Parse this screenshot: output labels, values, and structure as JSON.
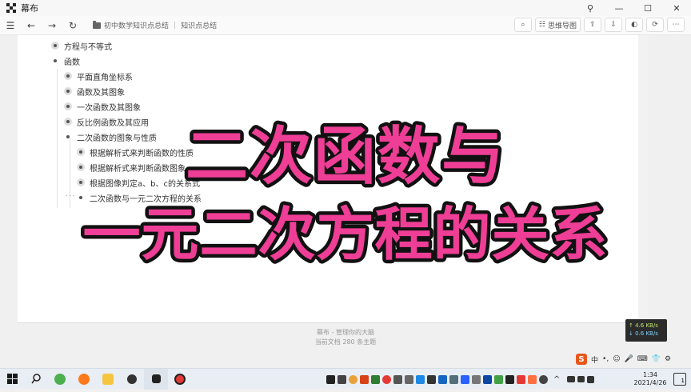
{
  "window": {
    "title": "幕布",
    "controls": {
      "pin": "⚲",
      "minimize": "—",
      "maximize": "☐",
      "close": "✕"
    }
  },
  "toolbar": {
    "menu_icon": "hamburger-icon",
    "back_icon": "arrow-left-icon",
    "forward_icon": "arrow-right-icon",
    "refresh_icon": "refresh-icon",
    "breadcrumb": [
      "初中数学知识点总结",
      "知识点总结"
    ],
    "breadcrumb_sep": "|",
    "mindmap_label": "思维导图",
    "right_icons": [
      "search-doc-icon",
      "mindmap-icon",
      "share-icon",
      "export-icon",
      "theme-icon",
      "history-icon",
      "more-icon"
    ]
  },
  "outline": {
    "items": [
      {
        "text": "方程与不等式",
        "level": 0,
        "collapsed": true
      },
      {
        "text": "函数",
        "level": 0,
        "collapsed": false
      },
      {
        "text": "平面直角坐标系",
        "level": 1,
        "collapsed": true
      },
      {
        "text": "函数及其图象",
        "level": 1,
        "collapsed": true
      },
      {
        "text": "一次函数及其图象",
        "level": 1,
        "collapsed": true
      },
      {
        "text": "反比例函数及其应用",
        "level": 1,
        "collapsed": true
      },
      {
        "text": "二次函数的图象与性质",
        "level": 1,
        "collapsed": false
      },
      {
        "text": "根据解析式来判断函数的性质",
        "level": 2,
        "collapsed": true
      },
      {
        "text": "根据解析式来判断函数图象",
        "level": 2,
        "collapsed": true
      },
      {
        "text": "根据图像判定a、b、c的关系式",
        "level": 2,
        "collapsed": true
      },
      {
        "text": "二次函数与一元二次方程的关系",
        "level": 2,
        "collapsed": false
      }
    ],
    "more_dots": "···"
  },
  "overlay": {
    "line1": "二次函数与",
    "line2": "一元二次方程的关系",
    "fill_color": "#ee3e96",
    "stroke_color": "#111111"
  },
  "footer": {
    "line1": "幕布 - 管理你的大脑",
    "line2": "当前文档 280 条主题"
  },
  "netspeed": {
    "up": "↑ 4.6 KB/s",
    "down": "↓ 0.6 KB/s"
  },
  "ime": {
    "logo": "S",
    "lang": "中",
    "items": [
      "•,",
      "☺",
      "🎤",
      "⌨",
      "👕",
      "⚙"
    ]
  },
  "taskbar": {
    "clock_time": "1:34",
    "clock_date": "2021/4/26",
    "notification_count": "1",
    "tray_up_arrow": "^"
  }
}
